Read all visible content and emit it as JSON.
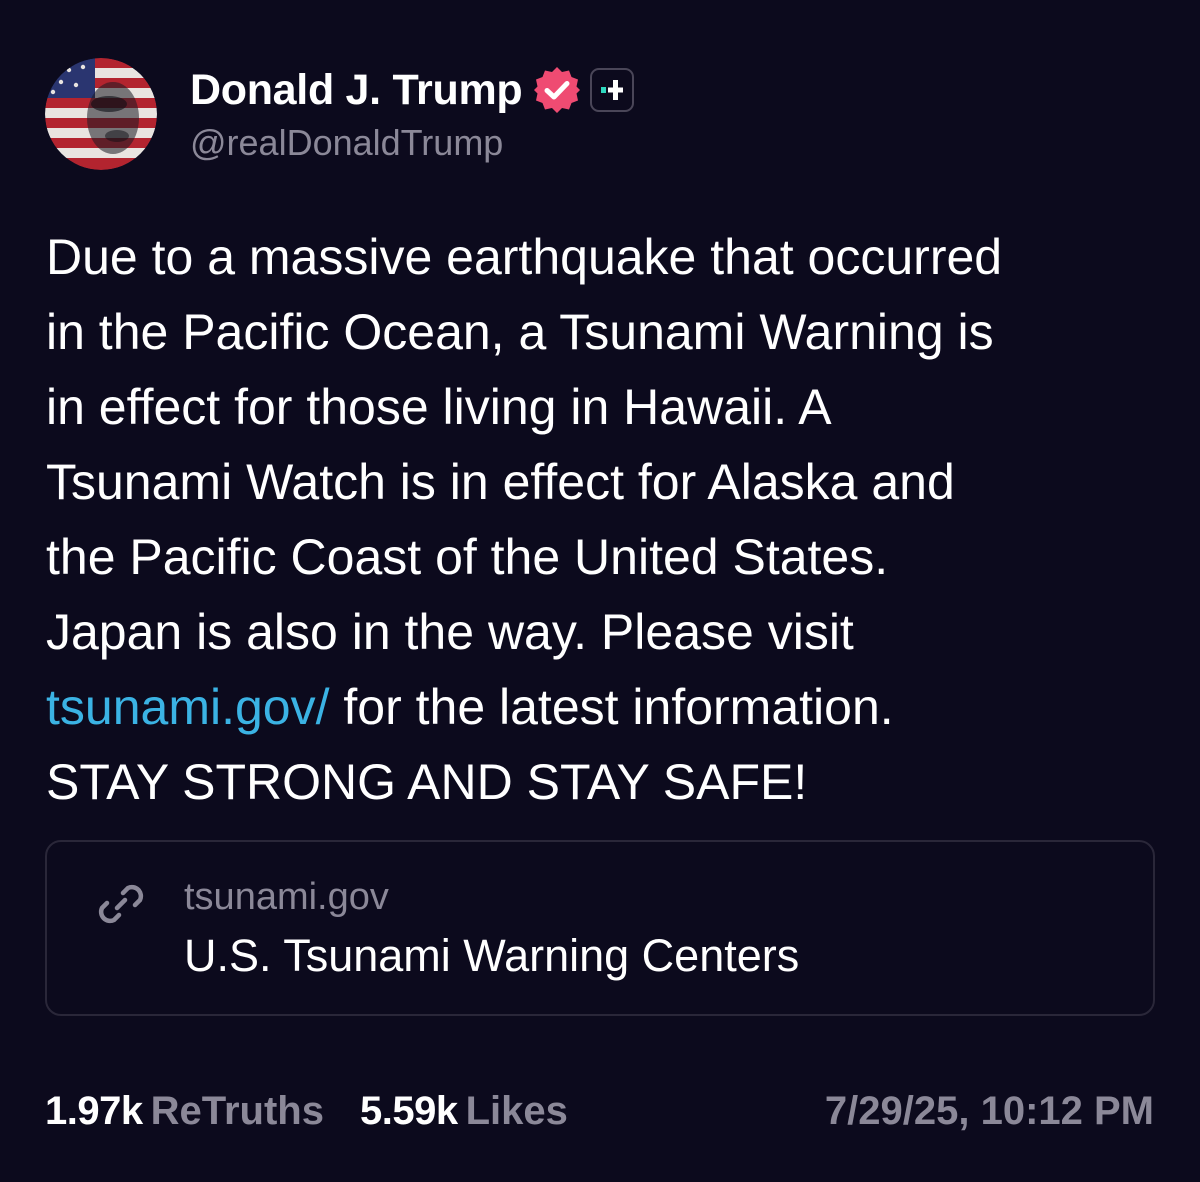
{
  "author": {
    "display_name": "Donald J. Trump",
    "handle": "@realDonaldTrump",
    "avatar_icon": "avatar-image",
    "verified_icon": "verified-badge-icon",
    "plus_badge_icon": "plus-badge-icon"
  },
  "post": {
    "lines": [
      "Due to a massive earthquake that occurred",
      "in the Pacific Ocean, a Tsunami Warning is",
      "in effect for those living in Hawaii. A",
      "Tsunami Watch is in effect for Alaska and",
      "the Pacific Coast of the United States.",
      "Japan is also in the way. Please visit"
    ],
    "link_text": "tsunami.gov/",
    "after_link": " for the latest information.",
    "closing_line": "STAY STRONG AND STAY SAFE!"
  },
  "link_card": {
    "icon": "link-icon",
    "domain": "tsunami.gov",
    "title": "U.S. Tsunami Warning Centers"
  },
  "stats": {
    "retruths_count": "1.97k",
    "retruths_label": "ReTruths",
    "likes_count": "5.59k",
    "likes_label": "Likes"
  },
  "timestamp": "7/29/25, 10:12 PM",
  "colors": {
    "background": "#0c0a1d",
    "text": "#ffffff",
    "muted": "#8b8898",
    "link": "#3bb3e4",
    "verified": "#ef4b72",
    "plus_accent": "#2fd8c0",
    "card_border": "#2a2739"
  }
}
